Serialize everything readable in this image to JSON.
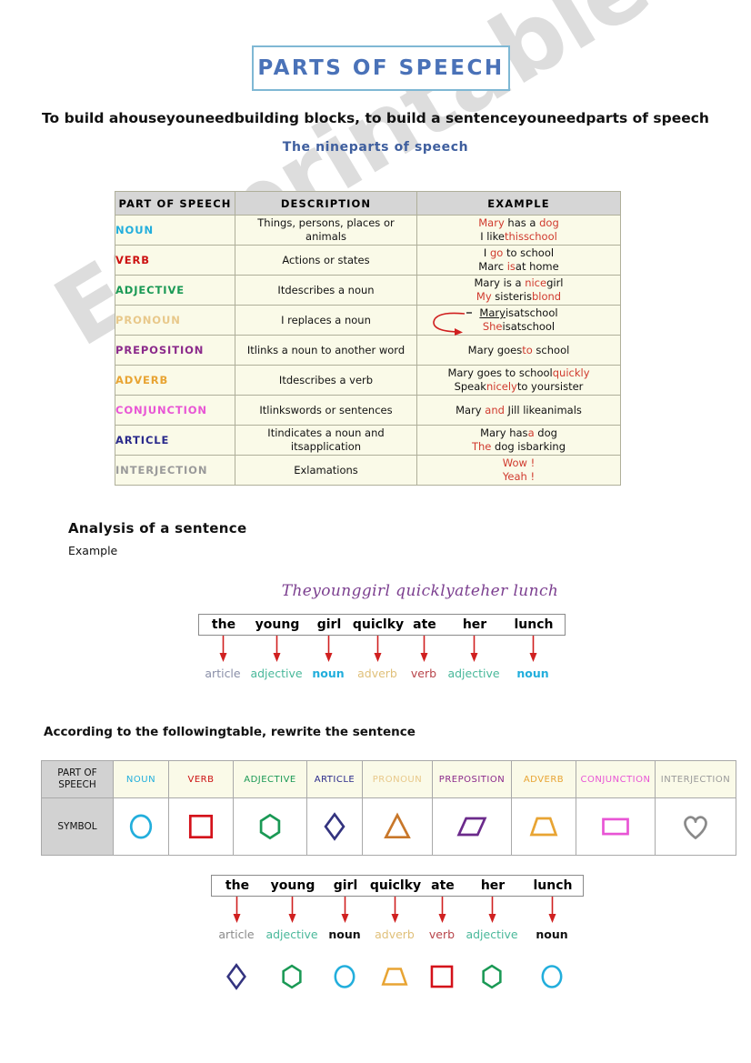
{
  "title": "PARTS OF SPEECH",
  "lead": "To build ahouseyouneedbuilding blocks, to build a sentenceyouneedparts of speech",
  "sublead": "The nineparts of speech",
  "watermark": "ESLprintables.com",
  "main_table": {
    "headers": [
      "PART OF SPEECH",
      "DESCRIPTION",
      "EXAMPLE"
    ],
    "rows": [
      {
        "pos": "NOUN",
        "color": "#22AEDC",
        "description": "Things, persons, places or animals",
        "example_line1_a": "",
        "example_line1_hl": "Mary",
        "example_line1_b": " has a ",
        "example_line1_hl2": "dog",
        "example_line1_c": "",
        "example_line2_a": "I like",
        "example_line2_hl": "this",
        "example_line2_b": "",
        "example_line2_hl2": "school",
        "example_line2_c": ""
      },
      {
        "pos": "VERB",
        "color": "#CC1111",
        "description": "Actions or states",
        "example_line1_a": "I ",
        "example_line1_hl": "go",
        "example_line1_b": " to school",
        "example_line1_hl2": "",
        "example_line1_c": "",
        "example_line2_a": "Marc ",
        "example_line2_hl": "is",
        "example_line2_b": "at home",
        "example_line2_hl2": "",
        "example_line2_c": ""
      },
      {
        "pos": "ADJECTIVE",
        "color": "#1A9955",
        "description": "Itdescribes a noun",
        "example_line1_a": "Mary is a ",
        "example_line1_hl": "nice",
        "example_line1_b": "girl",
        "example_line1_hl2": "",
        "example_line1_c": "",
        "example_line2_a": "",
        "example_line2_hl": "My",
        "example_line2_b": " sisteris",
        "example_line2_hl2": "blond",
        "example_line2_c": ""
      },
      {
        "pos": "PRONOUN",
        "color": "#E8C88A",
        "description": "I replaces a noun",
        "example_line1_a": "",
        "example_line1_hl": "",
        "example_line1_b": "",
        "example_line1_hl2": "",
        "example_line1_c": "",
        "example_line1_underline": "Mary",
        "example_line1_rest": "isatschool",
        "example_line2_a": "",
        "example_line2_hl": "She",
        "example_line2_b": "isatschool",
        "example_line2_hl2": "",
        "example_line2_c": "",
        "has_arrow": true
      },
      {
        "pos": "PREPOSITION",
        "color": "#8B2A8B",
        "description": "Itlinks a noun to another word",
        "example_line1_a": "Mary goes",
        "example_line1_hl": "to",
        "example_line1_b": " school",
        "example_line1_hl2": "",
        "example_line1_c": "",
        "example_line2_a": "",
        "example_line2_hl": "",
        "example_line2_b": "",
        "example_line2_hl2": "",
        "example_line2_c": ""
      },
      {
        "pos": "ADVERB",
        "color": "#E8A433",
        "description": "Itdescribes a verb",
        "example_line1_a": "Mary goes to school",
        "example_line1_hl": "quickly",
        "example_line1_b": "",
        "example_line1_hl2": "",
        "example_line1_c": "",
        "example_line2_a": "Speak",
        "example_line2_hl": "nicely",
        "example_line2_b": "to yoursister",
        "example_line2_hl2": "",
        "example_line2_c": ""
      },
      {
        "pos": "CONJUNCTION",
        "color": "#E855D5",
        "description": "Itlinkswords or sentences",
        "example_line1_a": "Mary ",
        "example_line1_hl": "and",
        "example_line1_b": " Jill likeanimals",
        "example_line1_hl2": "",
        "example_line1_c": "",
        "example_line2_a": "",
        "example_line2_hl": "",
        "example_line2_b": "",
        "example_line2_hl2": "",
        "example_line2_c": ""
      },
      {
        "pos": "ARTICLE",
        "color": "#2A2A8B",
        "description_line1": "Itindicates a noun and",
        "description_line2": "itsapplication",
        "description": "Itindicates a noun and itsapplication",
        "example_line1_a": "Mary has",
        "example_line1_hl": "a",
        "example_line1_b": " dog",
        "example_line1_hl2": "",
        "example_line1_c": "",
        "example_line2_a": "",
        "example_line2_hl": "The",
        "example_line2_b": " dog isbarking",
        "example_line2_hl2": "",
        "example_line2_c": ""
      },
      {
        "pos": "INTERJECTION",
        "color": "#9A9A9A",
        "description": "Exlamations",
        "example_line1_a": "",
        "example_line1_hl": "Wow !",
        "example_line1_b": "",
        "example_line1_hl2": "",
        "example_line1_c": "",
        "example_line2_a": "",
        "example_line2_hl": "Yeah !",
        "example_line2_b": "",
        "example_line2_hl2": "",
        "example_line2_c": ""
      }
    ]
  },
  "analysis": {
    "heading": "Analysis of a sentence",
    "example_label": "Example",
    "cursive_sentence": "Theyounggirl quicklyateher lunch",
    "words": [
      "the",
      "young",
      "girl",
      "quiclky",
      "ate",
      "her",
      "lunch"
    ],
    "labels": [
      "article",
      "adjective",
      "noun",
      "adverb",
      "verb",
      "adjective",
      "noun"
    ],
    "label_colors": [
      "#8A8FA8",
      "#49B89A",
      "#22AEDC",
      "#E0C07A",
      "#B8444A",
      "#49B89A",
      "#22AEDC"
    ],
    "label_bold": [
      false,
      false,
      true,
      false,
      false,
      false,
      true
    ],
    "arrow_color": "#D02020"
  },
  "symbol_table": {
    "instruction": "According to the followingtable, rewrite the sentence",
    "row_labels": [
      "PART OF SPEECH",
      "SYMBOL"
    ],
    "parts": [
      {
        "name": "NOUN",
        "color": "#22AEDC",
        "shape": "circle",
        "shape_color": "#22AEDC"
      },
      {
        "name": "VERB",
        "color": "#CC1111",
        "shape": "square",
        "shape_color": "#D4111A"
      },
      {
        "name": "ADJECTIVE",
        "color": "#1A9955",
        "shape": "hexagon",
        "shape_color": "#1A9955"
      },
      {
        "name": "ARTICLE",
        "color": "#2A2A8B",
        "shape": "diamond",
        "shape_color": "#33337F"
      },
      {
        "name": "PRONOUN",
        "color": "#E8C88A",
        "shape": "triangle",
        "shape_color": "#C8772A"
      },
      {
        "name": "PREPOSITION",
        "color": "#8B2A8B",
        "shape": "parallelogram",
        "shape_color": "#6B2A8B"
      },
      {
        "name": "ADVERB",
        "color": "#E8A433",
        "shape": "trapezoid",
        "shape_color": "#E8A433"
      },
      {
        "name": "CONJUNCTION",
        "color": "#E855D5",
        "shape": "rectangle",
        "shape_color": "#E855D5"
      },
      {
        "name": "INTERJECTION",
        "color": "#9A9A9A",
        "shape": "heart",
        "shape_color": "#8A8A8A"
      }
    ]
  },
  "exercise": {
    "words": [
      "the",
      "young",
      "girl",
      "quiclky",
      "ate",
      "her",
      "lunch"
    ],
    "labels": [
      "article",
      "adjective",
      "noun",
      "adverb",
      "verb",
      "adjective",
      "noun"
    ],
    "label_colors": [
      "#8A8A8A",
      "#49B89A",
      "#111111",
      "#E0C07A",
      "#B8444A",
      "#49B89A",
      "#111111"
    ],
    "label_bold": [
      false,
      false,
      true,
      false,
      false,
      false,
      true
    ],
    "shapes": [
      "diamond",
      "hexagon",
      "circle",
      "trapezoid",
      "square",
      "hexagon",
      "circle"
    ],
    "shape_colors": [
      "#33337F",
      "#1A9955",
      "#22AEDC",
      "#E8A433",
      "#D4111A",
      "#1A9955",
      "#22AEDC"
    ],
    "arrow_color": "#D02020"
  }
}
